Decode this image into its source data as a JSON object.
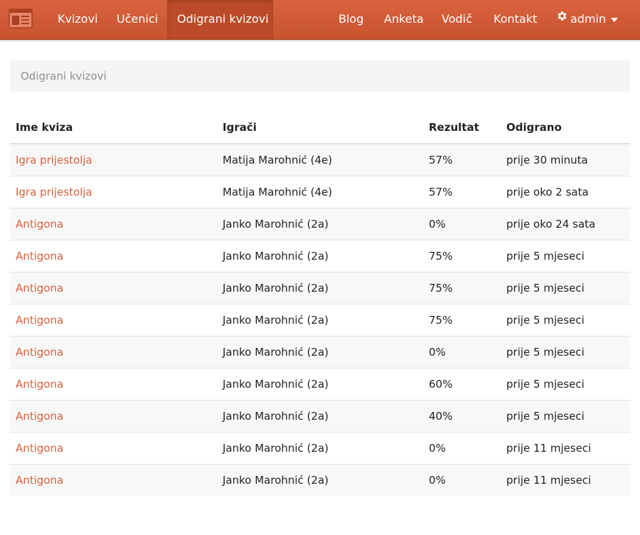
{
  "navbar": {
    "brand_icon": "browser-window-icon",
    "left_items": [
      {
        "label": "Kvizovi"
      },
      {
        "label": "Učenici"
      },
      {
        "label": "Odigrani kvizovi",
        "active": true
      }
    ],
    "right_items": [
      {
        "label": "Blog"
      },
      {
        "label": "Anketa"
      },
      {
        "label": "Vodič"
      },
      {
        "label": "Kontakt"
      }
    ],
    "user_menu": {
      "label": "admin",
      "icon": "gear-icon",
      "caret_icon": "caret-down-icon"
    },
    "colors": {
      "bar": "#d05b36",
      "active": "#bb4b28",
      "text": "#ffffff"
    }
  },
  "breadcrumb": {
    "current": "Odigrani kvizovi"
  },
  "table": {
    "headers": [
      "Ime kviza",
      "Igrači",
      "Rezultat",
      "Odigrano"
    ],
    "rows": [
      {
        "quiz": "Igra prijestolja",
        "players": "Matija Marohnić (4e)",
        "result": "57%",
        "played": "prije 30 minuta"
      },
      {
        "quiz": "Igra prijestolja",
        "players": "Matija Marohnić (4e)",
        "result": "57%",
        "played": "prije oko 2 sata"
      },
      {
        "quiz": "Antigona",
        "players": "Janko Marohnić (2a)",
        "result": "0%",
        "played": "prije oko 24 sata"
      },
      {
        "quiz": "Antigona",
        "players": "Janko Marohnić (2a)",
        "result": "75%",
        "played": "prije 5 mjeseci"
      },
      {
        "quiz": "Antigona",
        "players": "Janko Marohnić (2a)",
        "result": "75%",
        "played": "prije 5 mjeseci"
      },
      {
        "quiz": "Antigona",
        "players": "Janko Marohnić (2a)",
        "result": "75%",
        "played": "prije 5 mjeseci"
      },
      {
        "quiz": "Antigona",
        "players": "Janko Marohnić (2a)",
        "result": "0%",
        "played": "prije 5 mjeseci"
      },
      {
        "quiz": "Antigona",
        "players": "Janko Marohnić (2a)",
        "result": "60%",
        "played": "prije 5 mjeseci"
      },
      {
        "quiz": "Antigona",
        "players": "Janko Marohnić (2a)",
        "result": "40%",
        "played": "prije 5 mjeseci"
      },
      {
        "quiz": "Antigona",
        "players": "Janko Marohnić (2a)",
        "result": "0%",
        "played": "prije 11 mjeseci"
      },
      {
        "quiz": "Antigona",
        "players": "Janko Marohnić (2a)",
        "result": "0%",
        "played": "prije 11 mjeseci"
      }
    ],
    "link_color": "#d9603b"
  }
}
